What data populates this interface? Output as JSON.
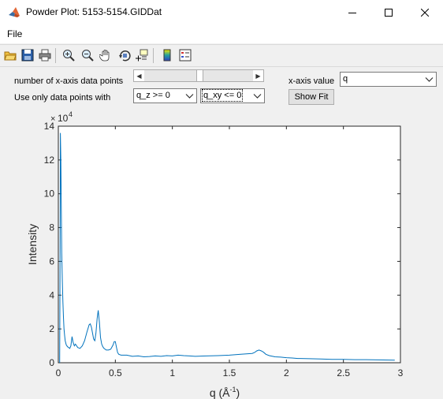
{
  "window": {
    "title": "Powder Plot: 5153-5154.GIDDat"
  },
  "menu": {
    "file": "File"
  },
  "toolbar": {
    "icons": [
      "open-icon",
      "save-icon",
      "print-icon",
      "zoom-in-icon",
      "zoom-out-icon",
      "pan-icon",
      "rotate-icon",
      "data-cursor-icon",
      "colorbar-icon",
      "legend-icon"
    ]
  },
  "controls": {
    "xpoints_label": "number of x-axis data points",
    "filter_label": "Use only data points with",
    "qz_value": "q_z >= 0",
    "qxy_value": "q_xy <= 0",
    "xaxis_label": "x-axis value",
    "xaxis_value": "q",
    "show_fit": "Show Fit",
    "slider_fraction": 0.5
  },
  "colors": {
    "line": "#0072bd",
    "plot_bg": "#ffffff",
    "window_bg": "#f0f0f0"
  },
  "chart_data": {
    "type": "line",
    "xlabel": "q (Å",
    "xlabel_sup": "-1",
    "xlabel_end": ")",
    "ylabel": "Intensity",
    "exponent_prefix": "×",
    "exponent_base": "10",
    "exponent_power": "4",
    "xlim": [
      0,
      3
    ],
    "ylim": [
      0,
      14
    ],
    "xticks": [
      "0",
      "0.5",
      "1",
      "1.5",
      "2",
      "2.5",
      "3"
    ],
    "yticks": [
      "0",
      "2",
      "4",
      "6",
      "8",
      "10",
      "12",
      "14"
    ],
    "grid": false,
    "series": [
      {
        "x": [
          0.012,
          0.015,
          0.018,
          0.022,
          0.026,
          0.03,
          0.035,
          0.04,
          0.045,
          0.05,
          0.055,
          0.06,
          0.07,
          0.08,
          0.09,
          0.1,
          0.11,
          0.12,
          0.13,
          0.14,
          0.15,
          0.17,
          0.19,
          0.21,
          0.23,
          0.25,
          0.27,
          0.28,
          0.29,
          0.3,
          0.31,
          0.32,
          0.33,
          0.34,
          0.35,
          0.36,
          0.37,
          0.38,
          0.39,
          0.4,
          0.42,
          0.44,
          0.46,
          0.48,
          0.49,
          0.5,
          0.51,
          0.52,
          0.53,
          0.55,
          0.6,
          0.65,
          0.7,
          0.75,
          0.8,
          0.85,
          0.9,
          0.95,
          1.0,
          1.05,
          1.1,
          1.15,
          1.2,
          1.3,
          1.4,
          1.5,
          1.6,
          1.7,
          1.72,
          1.74,
          1.76,
          1.78,
          1.8,
          1.82,
          1.85,
          1.9,
          1.95,
          2.0,
          2.05,
          2.1,
          2.2,
          2.3,
          2.4,
          2.5,
          2.6,
          2.7,
          2.8,
          2.9,
          2.95
        ],
        "y": [
          0.0,
          6.0,
          13.6,
          12.0,
          9.0,
          6.5,
          4.8,
          3.6,
          2.7,
          2.0,
          1.6,
          1.3,
          1.05,
          0.95,
          0.9,
          0.85,
          1.0,
          1.55,
          1.2,
          1.0,
          1.1,
          0.9,
          0.85,
          1.0,
          1.3,
          1.8,
          2.25,
          2.3,
          2.1,
          1.75,
          1.4,
          1.3,
          1.75,
          2.6,
          3.1,
          2.4,
          1.5,
          1.1,
          0.95,
          0.85,
          0.75,
          0.75,
          0.8,
          1.05,
          1.25,
          1.25,
          0.9,
          0.6,
          0.5,
          0.45,
          0.45,
          0.38,
          0.4,
          0.35,
          0.37,
          0.4,
          0.38,
          0.42,
          0.4,
          0.45,
          0.42,
          0.4,
          0.38,
          0.4,
          0.42,
          0.45,
          0.5,
          0.55,
          0.6,
          0.7,
          0.75,
          0.7,
          0.62,
          0.5,
          0.42,
          0.35,
          0.33,
          0.3,
          0.28,
          0.25,
          0.24,
          0.22,
          0.2,
          0.2,
          0.18,
          0.18,
          0.17,
          0.16,
          0.15
        ]
      }
    ]
  }
}
